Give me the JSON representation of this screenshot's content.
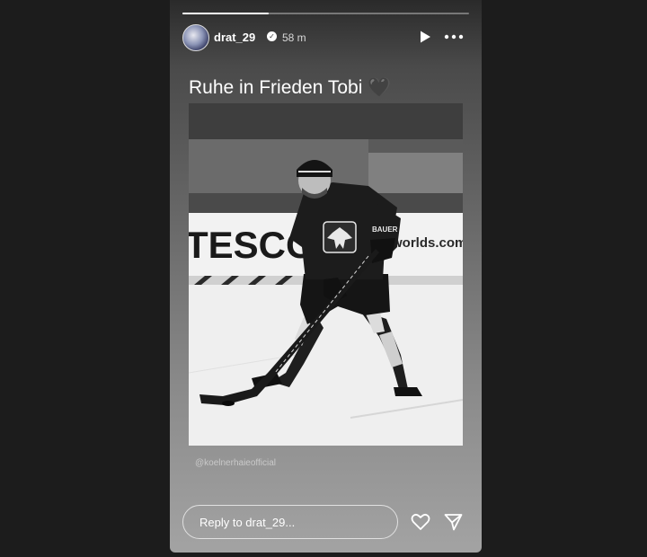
{
  "story": {
    "progress": 0.3,
    "username": "drat_29",
    "verified": true,
    "time_ago": "58 m",
    "caption": "Ruhe in Frieden Tobi",
    "caption_emoji": "🖤",
    "credit": "@koelnerhaieofficial",
    "reply_placeholder": "Reply to drat_29..."
  },
  "photo": {
    "banner_left": "TESCO",
    "banner_right": "worlds.com",
    "glove_text": "BAUER"
  },
  "icons": {
    "avatar": "avatar-image",
    "verified": "verified-badge-icon",
    "play": "play-icon",
    "more": "more-options-icon",
    "like": "heart-icon",
    "send": "send-icon"
  }
}
